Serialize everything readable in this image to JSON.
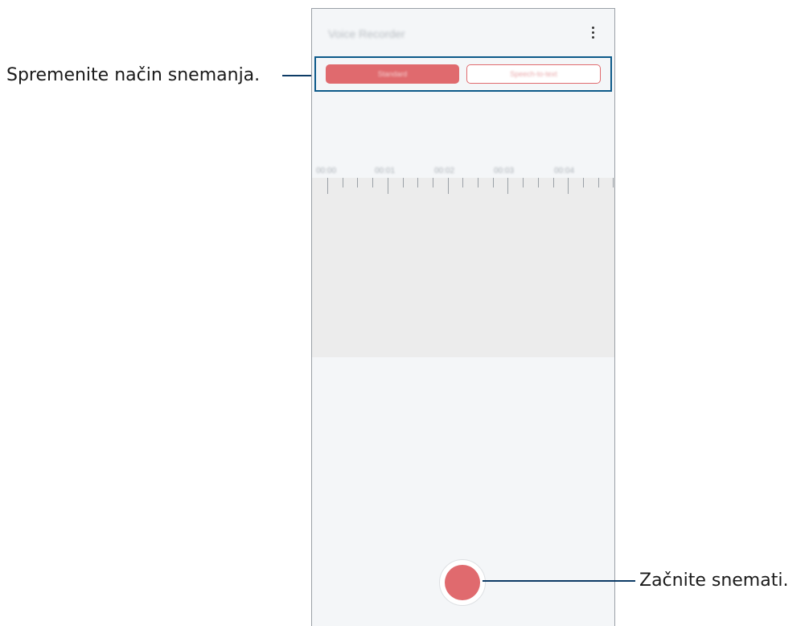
{
  "app": {
    "title": "Voice Recorder",
    "menu_icon": "more-options-icon"
  },
  "modes": {
    "standard_label": "Standard",
    "speech_label": "Speech-to-text",
    "active": "Standard"
  },
  "timeline": {
    "labels": [
      "00:00",
      "00:01",
      "00:02",
      "00:03",
      "00:04"
    ]
  },
  "callouts": {
    "mode_text": "Spremenite način snemanja.",
    "record_text": "Začnite snemati."
  },
  "colors": {
    "accent": "#e06a6e",
    "callout_line": "#0d3b66",
    "highlight_box": "#0d5a8a"
  }
}
